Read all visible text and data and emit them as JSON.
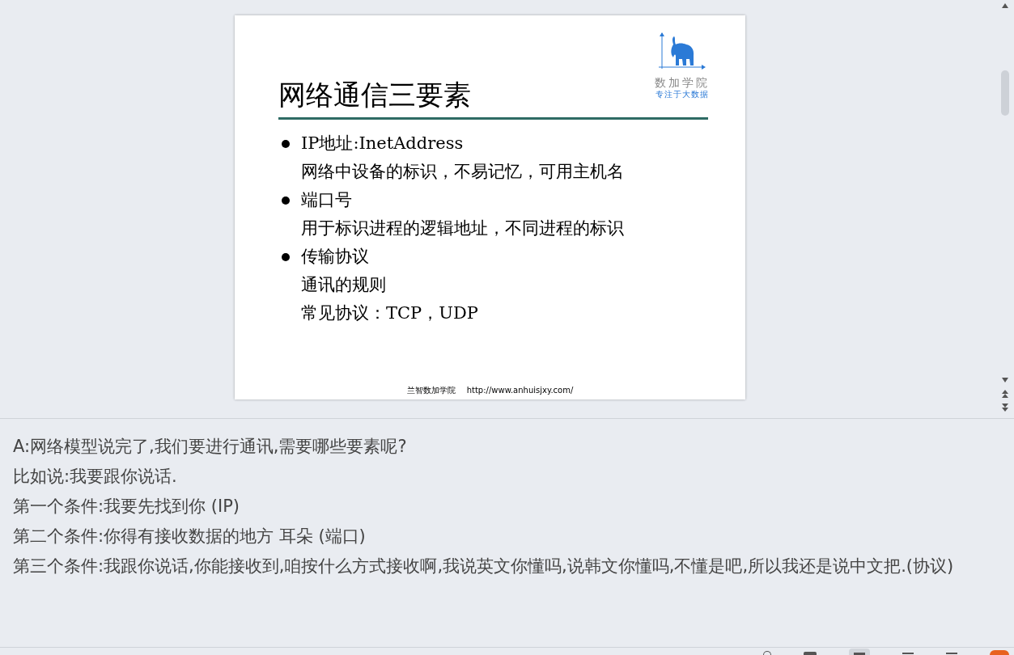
{
  "slide": {
    "title": "网络通信三要素",
    "logo": {
      "name": "数加学院",
      "slogan": "专注于大数据"
    },
    "items": [
      {
        "kind": "bullet",
        "text": "IP地址:InetAddress"
      },
      {
        "kind": "line",
        "text": "网络中设备的标识，不易记忆，可用主机名"
      },
      {
        "kind": "bullet",
        "text": "端口号"
      },
      {
        "kind": "line",
        "text": "用于标识进程的逻辑地址，不同进程的标识"
      },
      {
        "kind": "bullet",
        "text": "传输协议"
      },
      {
        "kind": "line",
        "text": "通讯的规则"
      },
      {
        "kind": "line",
        "text": "常见协议：TCP，UDP"
      }
    ],
    "footer": {
      "org": "兰智数加学院",
      "url": "http://www.anhuisjxy.com/"
    }
  },
  "notes": [
    "A:网络模型说完了,我们要进行通讯,需要哪些要素呢?",
    "比如说:我要跟你说话.",
    "第一个条件:我要先找到你 (IP)",
    "第二个条件:你得有接收数据的地方  耳朵 (端口)",
    "第三个条件:我跟你说话,你能接收到,咱按什么方式接收啊,我说英文你懂吗,说韩文你懂吗,不懂是吧,所以我还是说中文把.(协议)"
  ]
}
